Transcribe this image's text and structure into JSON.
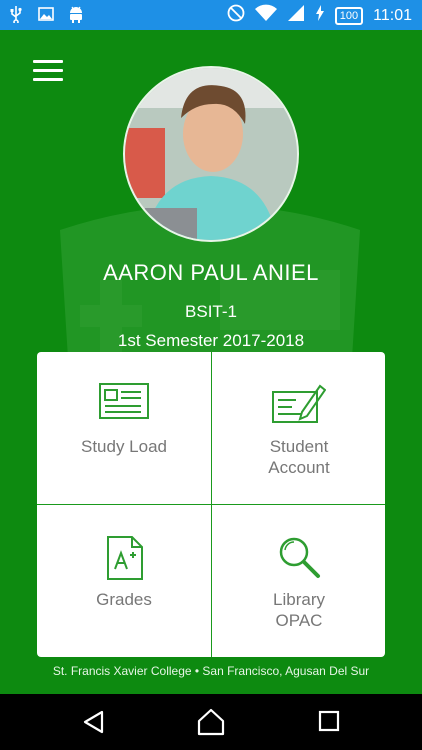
{
  "status_bar": {
    "time": "11:01",
    "battery": "100",
    "icons_left": [
      "usb-icon",
      "image-icon",
      "android-icon"
    ],
    "icons_right": [
      "do-not-disturb-icon",
      "wifi-icon",
      "signal-icon",
      "charging-icon"
    ]
  },
  "profile": {
    "name": "AARON PAUL ANIEL",
    "course": "BSIT-1",
    "semester": "1st Semester 2017-2018"
  },
  "menu": {
    "study_load": {
      "label": "Study Load",
      "icon": "id-card-icon"
    },
    "student_account": {
      "line1": "Student",
      "line2": "Account",
      "icon": "edit-account-icon"
    },
    "grades": {
      "label": "Grades",
      "icon": "grades-document-icon"
    },
    "library": {
      "line1": "Library",
      "line2": "OPAC",
      "icon": "search-icon"
    }
  },
  "footer": {
    "text": "St. Francis Xavier College • San Francisco, Agusan Del Sur"
  },
  "nav": [
    "back-icon",
    "home-icon",
    "recents-icon"
  ],
  "colors": {
    "status_bar": "#1e90e6",
    "background": "#0d8a10",
    "tile_divider": "#1a9a1d",
    "icon_green": "#2e9d31"
  }
}
